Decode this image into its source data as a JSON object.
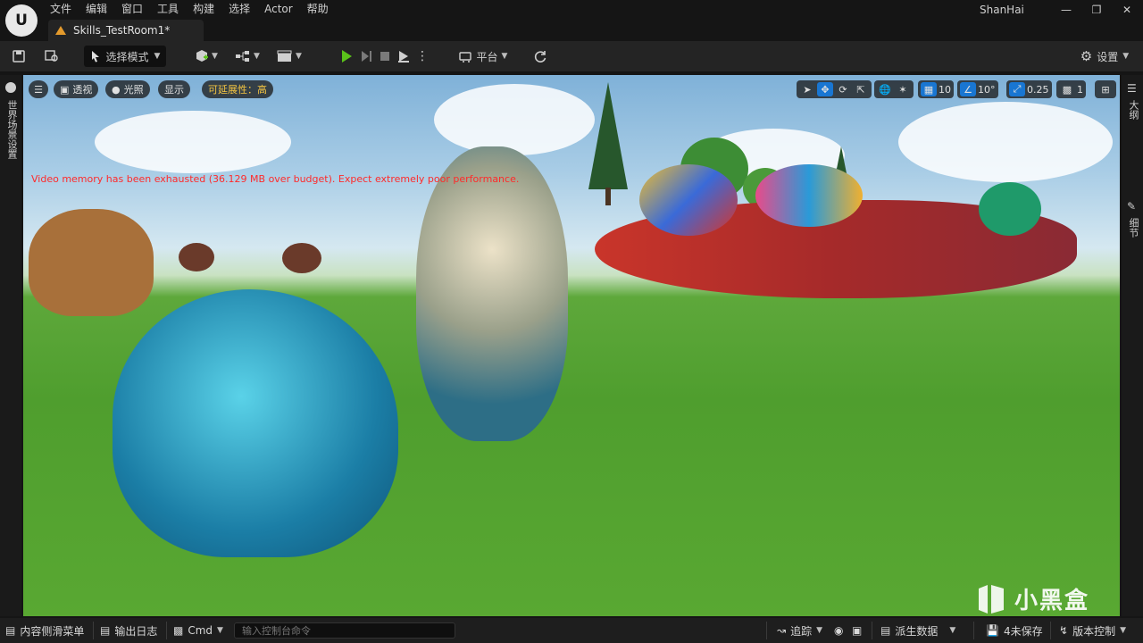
{
  "app": {
    "logo_letter": "U",
    "user": "ShanHai"
  },
  "menu": [
    "文件",
    "编辑",
    "窗口",
    "工具",
    "构建",
    "选择",
    "Actor",
    "帮助"
  ],
  "tab": {
    "label": "Skills_TestRoom1*"
  },
  "toolbar": {
    "mode_label": "选择模式",
    "platform_label": "平台",
    "settings_label": "设置"
  },
  "viewport_bar": {
    "perspective_label": "透视",
    "lighting_label": "光照",
    "show_label": "显示",
    "scalability_label": "可延展性：高",
    "grid_snap": "10",
    "rotation_snap": "10°",
    "scale_snap": "0.25",
    "camera_speed": "1"
  },
  "warning": "Video memory has been exhausted (36.129 MB over budget). Expect extremely poor performance.",
  "left_panel": {
    "world_settings_label": "世界场景设置"
  },
  "right_panel": {
    "outliner_label": "大纲",
    "details_label": "细节"
  },
  "statusbar": {
    "content_drawer": "内容侧滑菜单",
    "output_log": "输出日志",
    "cmd_label": "Cmd",
    "console_placeholder": "输入控制台命令",
    "trace_label": "追踪",
    "derived_data": "派生数据",
    "unsaved": "4未保存",
    "source_control": "版本控制"
  },
  "watermark": {
    "text": "小黑盒"
  },
  "colors": {
    "accent": "#1976d2",
    "play_green": "#5ac21a",
    "warning_red": "#ff2a2a",
    "scalability_yellow": "#f5c542"
  }
}
